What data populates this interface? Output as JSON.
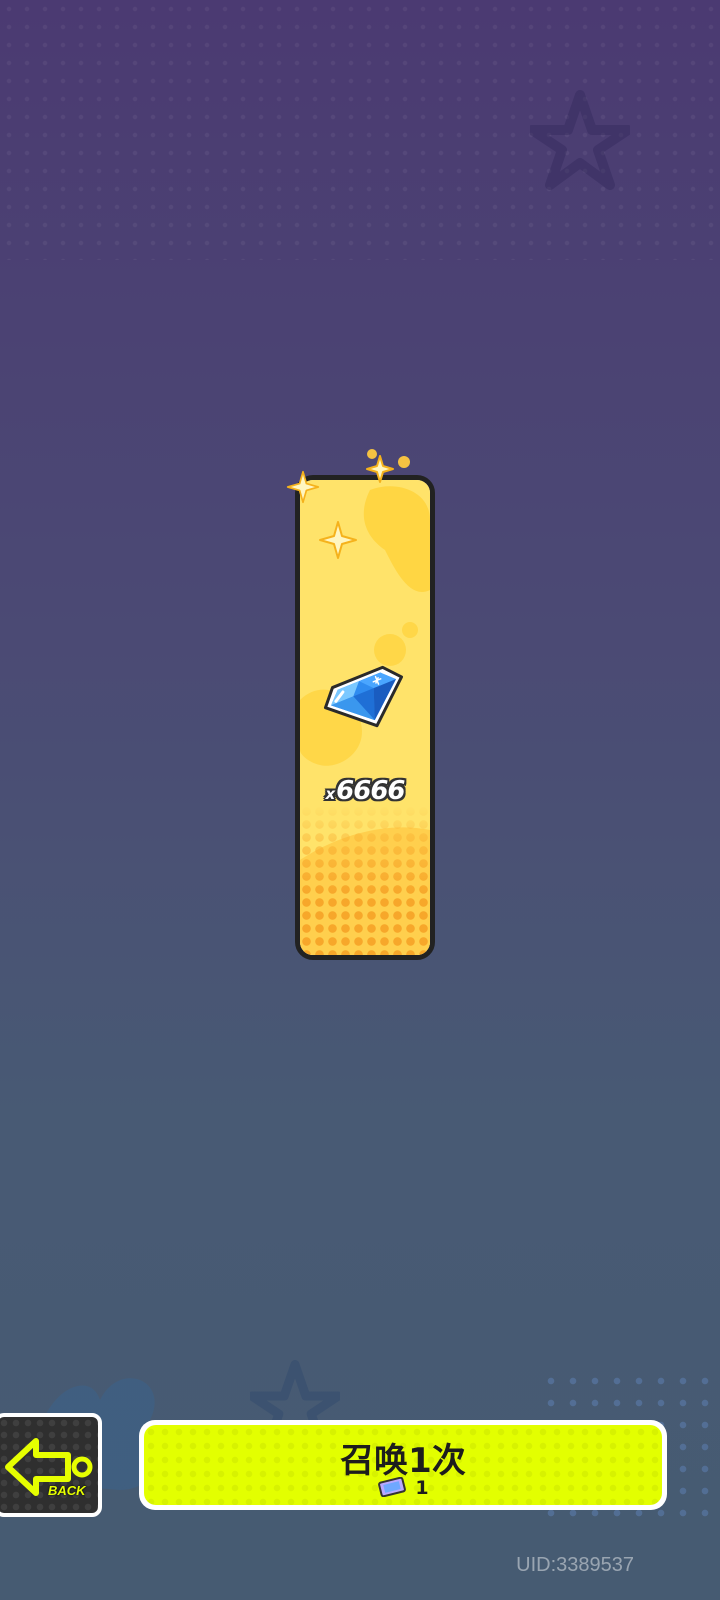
{
  "reward_card": {
    "item_icon": "blue-diamond-gem-icon",
    "quantity_prefix": "x",
    "quantity": "6666"
  },
  "back_button": {
    "icon": "arrow-left-icon",
    "label": "BACK"
  },
  "summon_button": {
    "label": "召唤1次",
    "cost_icon": "ticket-icon",
    "cost": "1"
  },
  "footer": {
    "uid": "UID:3389537"
  },
  "colors": {
    "card_yellow": "#ffe36a",
    "button_lime": "#e3ff00",
    "back_accent": "#e6ff00"
  }
}
